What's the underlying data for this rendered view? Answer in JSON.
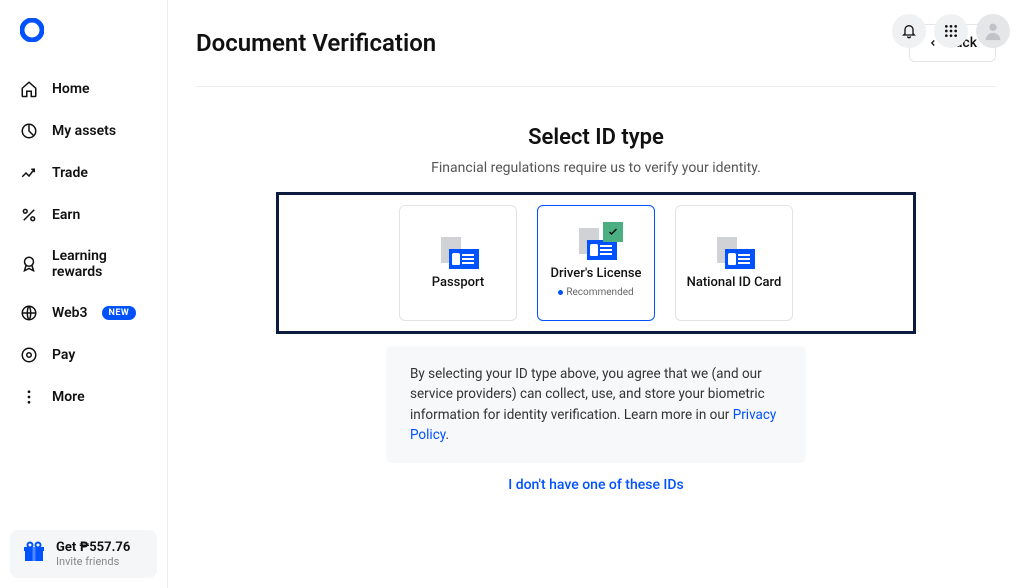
{
  "sidebar": {
    "items": [
      {
        "label": "Home"
      },
      {
        "label": "My assets"
      },
      {
        "label": "Trade"
      },
      {
        "label": "Earn"
      },
      {
        "label": "Learning rewards"
      },
      {
        "label": "Web3",
        "badge": "NEW"
      },
      {
        "label": "Pay"
      },
      {
        "label": "More"
      }
    ],
    "invite": {
      "title": "Get ₱557.76",
      "subtitle": "Invite friends"
    }
  },
  "header": {
    "back_label": "Back"
  },
  "page": {
    "title": "Document Verification",
    "section_title": "Select ID type",
    "section_subtitle": "Financial regulations require us to verify your identity.",
    "options": [
      {
        "label": "Passport",
        "recommended": false
      },
      {
        "label": "Driver's License",
        "recommended": true,
        "selected": true
      },
      {
        "label": "National ID Card",
        "recommended": false
      }
    ],
    "recommended_text": "Recommended",
    "disclaimer_text": "By selecting your ID type above, you agree that we (and our service providers) can collect, use, and store your biometric information for identity verification. Learn more in our ",
    "disclaimer_link": "Privacy Policy",
    "disclaimer_end": ".",
    "no_id_link": "I don't have one of these IDs"
  }
}
